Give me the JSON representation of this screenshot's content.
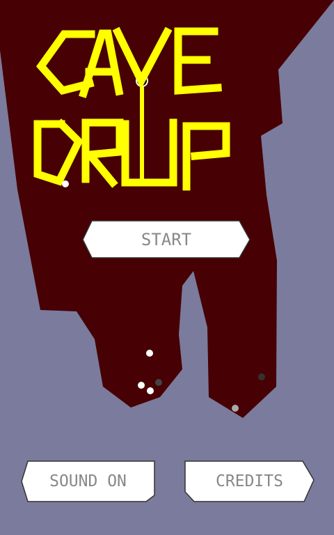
{
  "game": {
    "title": "CAVE DRIP",
    "colors": {
      "background": "#7b7b9d",
      "cave": "#470003",
      "title": "#ffff00",
      "button_fill": "#ffffff",
      "button_text": "#888888"
    }
  },
  "menu": {
    "start_label": "START",
    "sound_label": "SOUND ON",
    "credits_label": "CREDITS"
  }
}
